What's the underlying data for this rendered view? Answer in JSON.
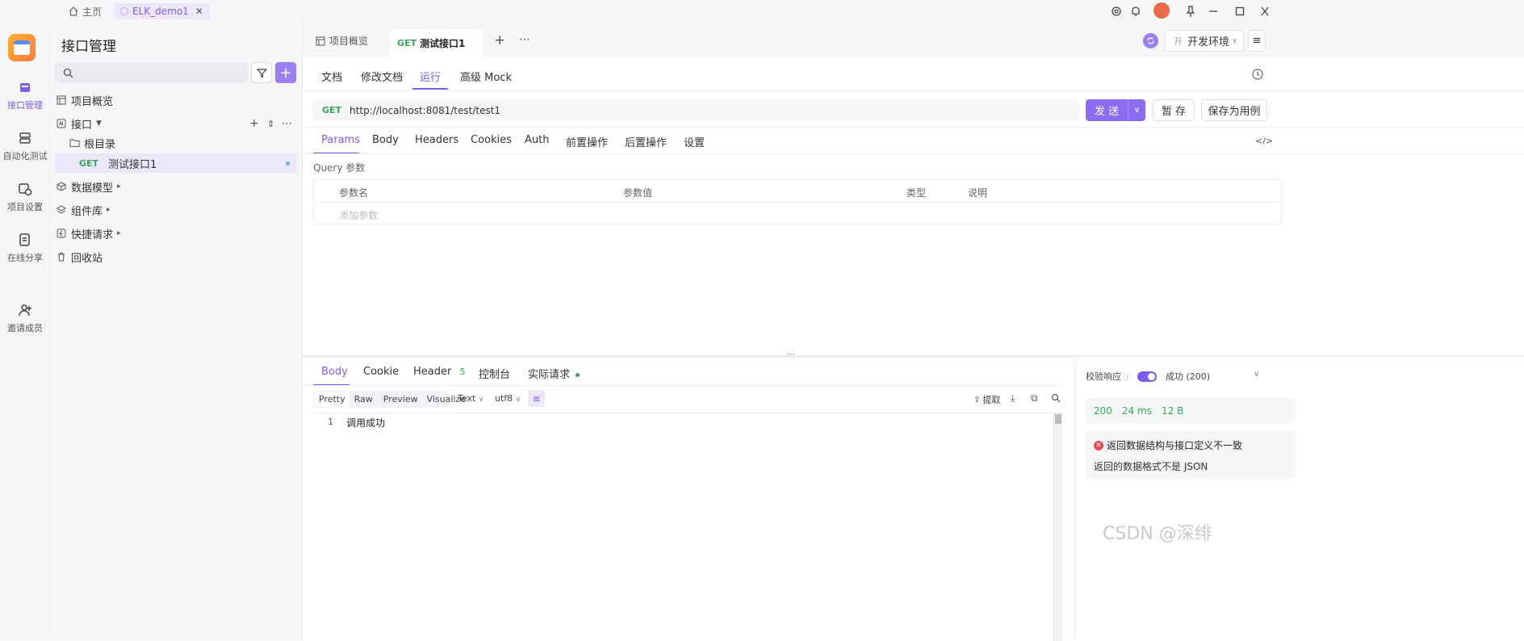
{
  "window": {
    "home_label": "主页",
    "tab_label": "ELK_demo1"
  },
  "rail": {
    "items": [
      {
        "label": "接口管理",
        "icon": "api-icon",
        "active": true
      },
      {
        "label": "自动化测试",
        "icon": "automation-icon"
      },
      {
        "label": "项目设置",
        "icon": "project-settings-icon"
      },
      {
        "label": "在线分享",
        "icon": "share-icon"
      },
      {
        "label": "邀请成员",
        "icon": "invite-member-icon"
      }
    ]
  },
  "left_panel": {
    "title": "接口管理",
    "search_placeholder": "",
    "tree": {
      "overview": "项目概览",
      "interfaces": "接口",
      "root_dir": "根目录",
      "api_method": "GET",
      "api_name": "测试接口1",
      "data_model": "数据模型",
      "components": "组件库",
      "quick_request": "快捷请求",
      "recycle": "回收站"
    }
  },
  "main": {
    "tabs": [
      {
        "label": "项目概览"
      },
      {
        "method": "GET",
        "label": "测试接口1"
      }
    ],
    "env_prefix": "开",
    "env_label": "开发环境",
    "sub_tabs": [
      "文档",
      "修改文档",
      "运行",
      "高级 Mock"
    ],
    "request": {
      "method": "GET",
      "url": "http://localhost:8081/test/test1",
      "send_label": "发 送",
      "save_temp_label": "暂 存",
      "save_case_label": "保存为用例"
    },
    "param_tabs": [
      "Params",
      "Body",
      "Headers",
      "Cookies",
      "Auth",
      "前置操作",
      "后置操作",
      "设置"
    ],
    "query_title": "Query 参数",
    "table_headers": [
      "参数名",
      "参数值",
      "类型",
      "说明"
    ],
    "add_param_placeholder": "添加参数",
    "response": {
      "tabs": [
        "Body",
        "Cookie",
        "Header",
        "控制台",
        "实际请求"
      ],
      "header_count": "5",
      "view_modes": [
        "Pretty",
        "Raw",
        "Preview",
        "Visualize"
      ],
      "format": "Text",
      "encoding": "utf8",
      "extract_label": "提取",
      "line_number": "1",
      "body_text": "调用成功"
    },
    "validation": {
      "label": "校验响应",
      "result": "成功 (200)",
      "status": "200",
      "time": "24 ms",
      "size": "12 B",
      "error_title": "返回数据结构与接口定义不一致",
      "error_detail": "返回的数据格式不是 JSON"
    },
    "watermark": "CSDN @深绯"
  },
  "colors": {
    "accent": "#7e5bef",
    "get_method": "#3aa55d",
    "error": "#e34d59"
  }
}
